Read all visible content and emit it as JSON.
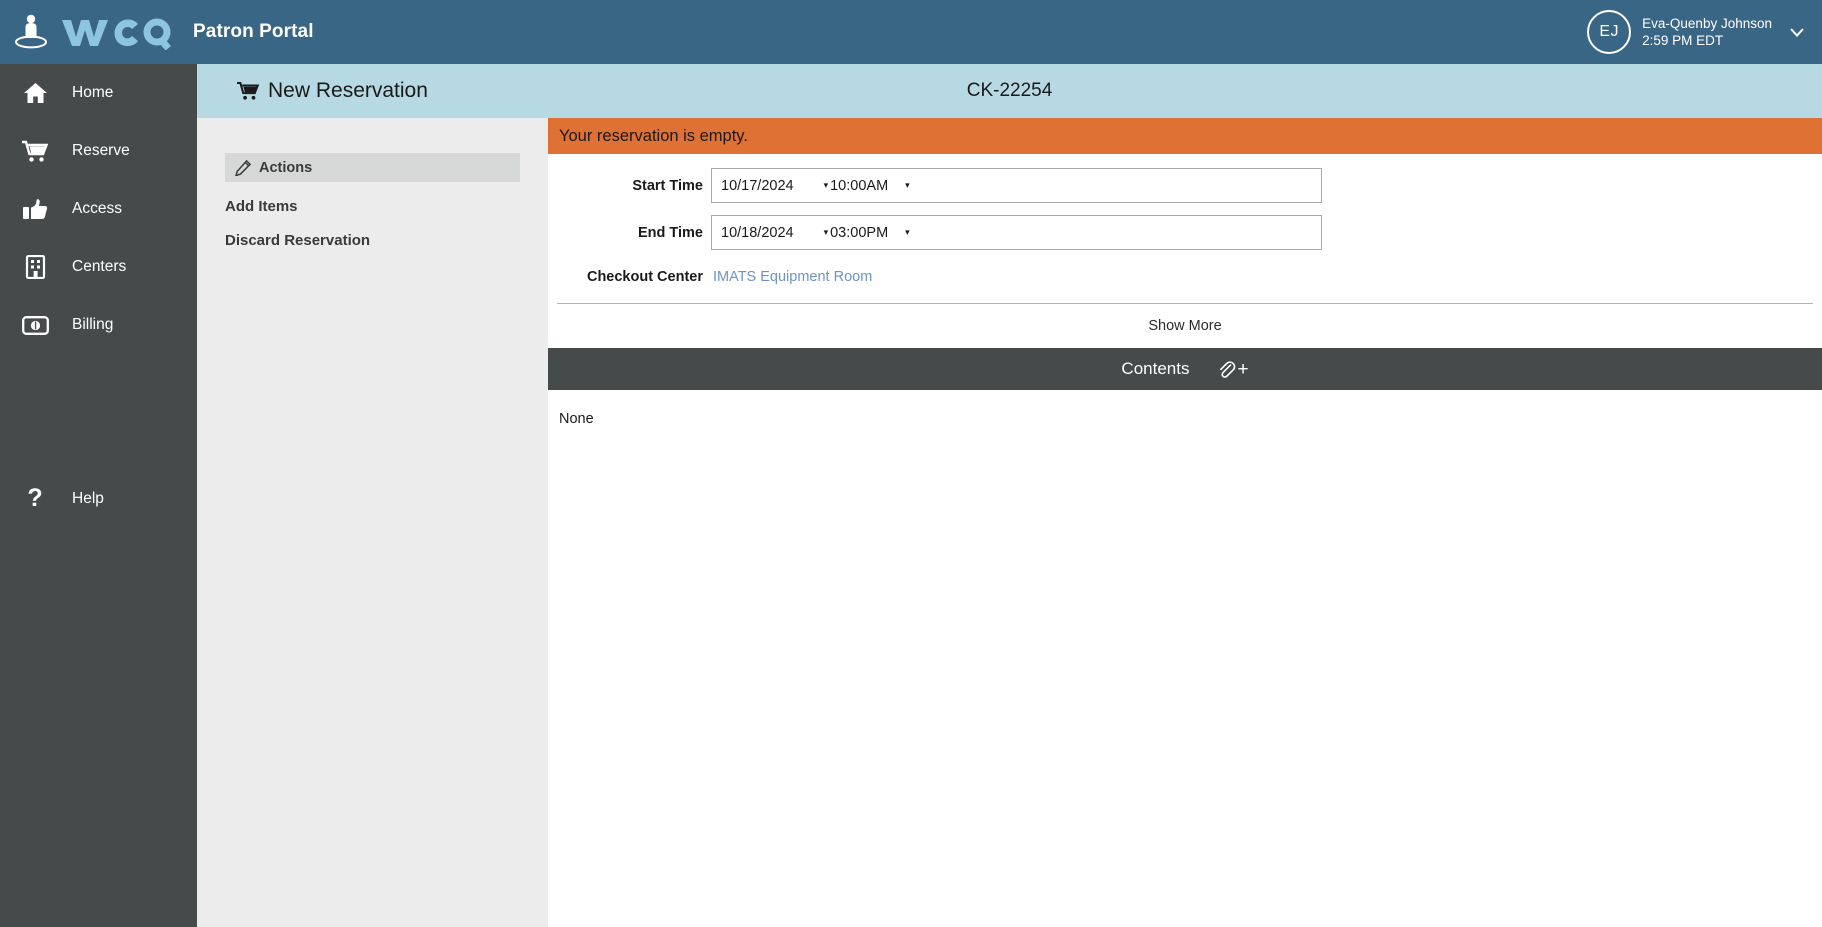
{
  "topbar": {
    "brand_name": "wco",
    "brand_sub": "Patron Portal",
    "logo_icon": "person-in-circle-logo",
    "user": {
      "initials": "EJ",
      "name": "Eva-Quenby Johnson",
      "time": "2:59 PM EDT",
      "caret_icon": "chevron-down-icon"
    }
  },
  "leftnav": {
    "items": [
      {
        "label": "Home",
        "icon": "home-icon"
      },
      {
        "label": "Reserve",
        "icon": "shopping-cart-icon"
      },
      {
        "label": "Access",
        "icon": "thumbs-up-icon"
      },
      {
        "label": "Centers",
        "icon": "building-icon"
      },
      {
        "label": "Billing",
        "icon": "money-bill-icon"
      }
    ],
    "help": {
      "label": "Help",
      "icon": "question-mark-icon"
    }
  },
  "page_header": {
    "title": "New Reservation",
    "title_icon": "shopping-cart-icon",
    "code": "CK-22254"
  },
  "subnav": {
    "actions_label": "Actions",
    "actions_icon": "pencil-icon",
    "links": [
      "Add Items",
      "Discard Reservation"
    ]
  },
  "main": {
    "alert": "Your reservation is empty.",
    "fields": [
      {
        "label": "Start Time",
        "date": "10/17/2024",
        "time": "10:00AM",
        "date_caret": "▾",
        "time_caret": "▾"
      },
      {
        "label": "End Time",
        "date": "10/18/2024",
        "time": "03:00PM",
        "date_caret": "▾",
        "time_caret": "▾"
      }
    ],
    "checkout_center": {
      "label": "Checkout Center",
      "value": "IMATS Equipment Room"
    },
    "show_more": "Show More",
    "contents": {
      "title": "Contents",
      "attach_icon": "paperclip-plus-icon",
      "attach_plus": "+",
      "body": "None"
    }
  },
  "colors": {
    "topbar": "#3a6685",
    "leftnav": "#464a4b",
    "page_header": "#b6d9e3",
    "alert": "#df7134",
    "subnav": "#ececec",
    "link": "#6f93c0",
    "brand_accent": "#8cc5dd"
  }
}
